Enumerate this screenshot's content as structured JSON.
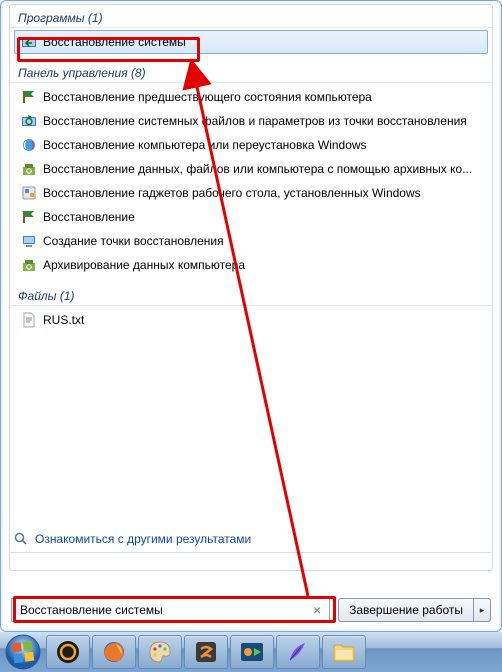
{
  "sections": {
    "programs": {
      "title": "Программы (1)"
    },
    "control_panel": {
      "title": "Панель управления (8)"
    },
    "files": {
      "title": "Файлы (1)"
    }
  },
  "programs": {
    "items": [
      {
        "label": "Восстановление системы",
        "icon": "restore-icon",
        "selected": true
      }
    ]
  },
  "control_panel": {
    "items": [
      {
        "label": "Восстановление предшествующего состояния компьютера",
        "icon": "flag-icon"
      },
      {
        "label": "Восстановление системных файлов и параметров из точки восстановления",
        "icon": "restore-icon"
      },
      {
        "label": "Восстановление компьютера или переустановка Windows",
        "icon": "restore-icon"
      },
      {
        "label": "Восстановление данных, файлов или компьютера с помощью архивных ко...",
        "icon": "backup-icon"
      },
      {
        "label": "Восстановление гаджетов рабочего стола, установленных Windows",
        "icon": "gadget-icon"
      },
      {
        "label": "Восстановление",
        "icon": "flag-icon"
      },
      {
        "label": "Создание точки восстановления",
        "icon": "system-icon"
      },
      {
        "label": "Архивирование данных компьютера",
        "icon": "backup-icon"
      }
    ]
  },
  "files": {
    "items": [
      {
        "label": "RUS.txt",
        "icon": "txt-icon"
      }
    ]
  },
  "see_more": {
    "label": "Ознакомиться с другими результатами"
  },
  "search": {
    "value": "Восстановление системы",
    "clear": "×"
  },
  "shutdown": {
    "label": "Завершение работы",
    "arrow": "▸"
  },
  "taskbar": {
    "items": [
      {
        "name": "start-orb"
      },
      {
        "name": "app-aimp"
      },
      {
        "name": "app-firefox"
      },
      {
        "name": "app-paint"
      },
      {
        "name": "app-sublime"
      },
      {
        "name": "app-media"
      },
      {
        "name": "app-feather"
      },
      {
        "name": "app-explorer"
      }
    ]
  },
  "colors": {
    "accent": "#0b4aa2",
    "annotation": "#e30000"
  }
}
